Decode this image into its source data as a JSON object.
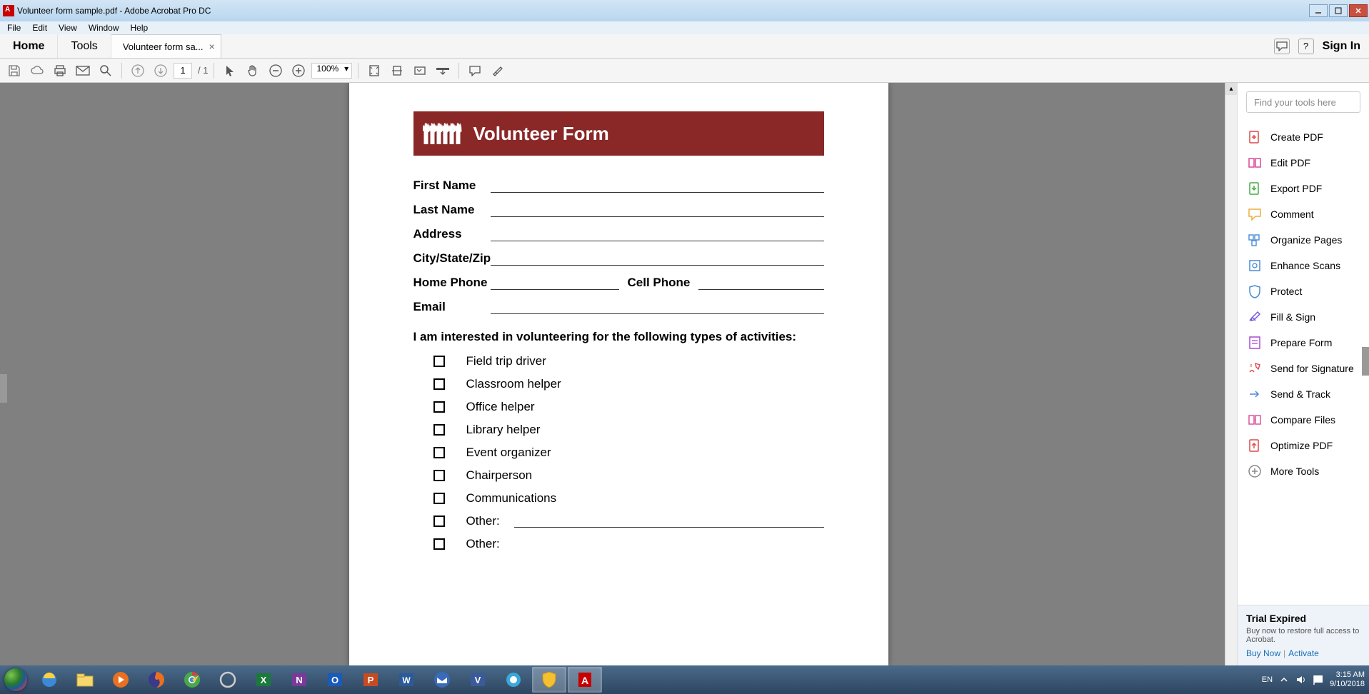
{
  "titlebar": {
    "text": "Volunteer form sample.pdf - Adobe Acrobat Pro DC"
  },
  "menu": [
    "File",
    "Edit",
    "View",
    "Window",
    "Help"
  ],
  "tabs": {
    "home": "Home",
    "tools": "Tools",
    "document": "Volunteer form sa...",
    "signin": "Sign In"
  },
  "toolbar": {
    "page_current": "1",
    "page_total": "/ 1",
    "zoom": "100%"
  },
  "pdf": {
    "banner_title": "Volunteer Form",
    "fields": {
      "first_name": "First Name",
      "last_name": "Last Name",
      "address": "Address",
      "city_state_zip": "City/State/Zip",
      "home_phone": "Home Phone",
      "cell_phone": "Cell Phone",
      "email": "Email"
    },
    "interest_heading": "I am interested in volunteering for the following types of activities:",
    "activities": [
      "Field trip driver",
      "Classroom helper",
      "Office helper",
      "Library helper",
      "Event organizer",
      "Chairperson",
      "Communications",
      "Other:",
      "Other:"
    ]
  },
  "tools_panel": {
    "search_placeholder": "Find your tools here",
    "items": [
      {
        "label": "Create PDF",
        "icon": "create-pdf-icon",
        "color": "#d84a4a"
      },
      {
        "label": "Edit PDF",
        "icon": "edit-pdf-icon",
        "color": "#d84a9a"
      },
      {
        "label": "Export PDF",
        "icon": "export-pdf-icon",
        "color": "#4aa84a"
      },
      {
        "label": "Comment",
        "icon": "comment-icon",
        "color": "#e8b040"
      },
      {
        "label": "Organize Pages",
        "icon": "organize-icon",
        "color": "#4a8ad8"
      },
      {
        "label": "Enhance Scans",
        "icon": "enhance-icon",
        "color": "#4a8ad8"
      },
      {
        "label": "Protect",
        "icon": "protect-icon",
        "color": "#4a8ad8"
      },
      {
        "label": "Fill & Sign",
        "icon": "fill-sign-icon",
        "color": "#7a5ad8"
      },
      {
        "label": "Prepare Form",
        "icon": "prepare-form-icon",
        "color": "#a84ad8"
      },
      {
        "label": "Send for Signature",
        "icon": "send-sig-icon",
        "color": "#d84a4a"
      },
      {
        "label": "Send & Track",
        "icon": "send-track-icon",
        "color": "#4a8ad8"
      },
      {
        "label": "Compare Files",
        "icon": "compare-icon",
        "color": "#d84a9a"
      },
      {
        "label": "Optimize PDF",
        "icon": "optimize-icon",
        "color": "#d84a4a"
      },
      {
        "label": "More Tools",
        "icon": "more-tools-icon",
        "color": "#888"
      }
    ]
  },
  "trial": {
    "title": "Trial Expired",
    "text": "Buy now to restore full access to Acrobat.",
    "buy": "Buy Now",
    "activate": "Activate"
  },
  "tray": {
    "lang": "EN",
    "time": "3:15 AM",
    "date": "9/10/2018"
  }
}
